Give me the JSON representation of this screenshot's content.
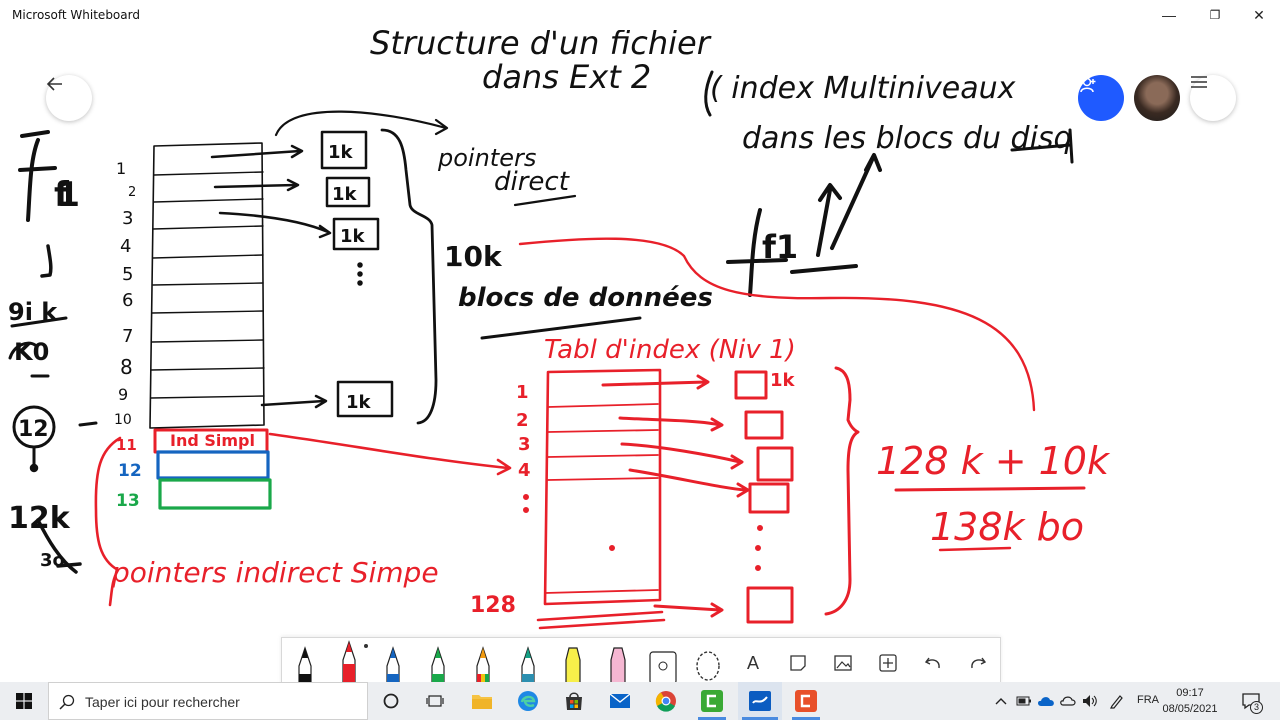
{
  "window": {
    "title": "Microsoft Whiteboard",
    "controls": {
      "minimize": "—",
      "maximize": "❐",
      "close": "✕"
    }
  },
  "buttons": {
    "back": "back-arrow-icon",
    "share": "person-add-icon",
    "menu": "hamburger-menu-icon"
  },
  "colors": {
    "ink_black": "#111111",
    "ink_red": "#e8202a",
    "ink_blue": "#1565c0",
    "ink_green": "#1aa84a",
    "share_button": "#1f5aff"
  },
  "whiteboard": {
    "heading_line1": "Structure d'un fichier",
    "heading_line2": "dans Ext 2",
    "note_index": "( index Multiniveaux",
    "note_disk": "dans les blocs du disq",
    "f1_right": "f1",
    "left_f1": "f1",
    "left_4k": "9i k",
    "left_4k_b": "K0",
    "left_12": "12",
    "left_12k": "12k",
    "left_3o": "3o",
    "row_numbers": [
      "1",
      "2",
      "3",
      "4",
      "5",
      "6",
      "7",
      "8",
      "9",
      "10"
    ],
    "red_row_11": "11",
    "blue_row_12": "12",
    "green_row_13": "13",
    "ind_simple": "Ind Simpl",
    "block_labels": [
      "1k",
      "1k",
      "1k",
      "1k"
    ],
    "vertical_dots": ":",
    "pointers_direct_1": "pointers",
    "pointers_direct_2": "direct",
    "ten_k": "10k",
    "blocs_donnees": "blocs de données",
    "table_title": "Tabl d'index (Niv 1)",
    "table_rows": [
      "1",
      "2",
      "3",
      "4"
    ],
    "table_last": "128",
    "table_block_label": "1k",
    "pointers_indirect": "pointers indirect Simpe",
    "sum_line": "128 k + 10k",
    "total_line": "138k bo"
  },
  "toolbar": {
    "tools": [
      "black-pen-icon",
      "red-pen-icon",
      "blue-pen-icon",
      "green-pen-icon",
      "rainbow-pen-icon",
      "galaxy-pen-icon",
      "yellow-highlighter-icon",
      "pink-highlighter-icon",
      "ruler-icon",
      "lasso-icon",
      "text-icon",
      "sticky-note-icon",
      "image-icon",
      "add-icon",
      "undo-icon",
      "redo-icon"
    ],
    "text_tool_label": "A"
  },
  "taskbar": {
    "search_placeholder": "Taper ici pour rechercher",
    "language": "FRA",
    "time": "09:17",
    "date": "08/05/2021",
    "notification_count": "3"
  }
}
